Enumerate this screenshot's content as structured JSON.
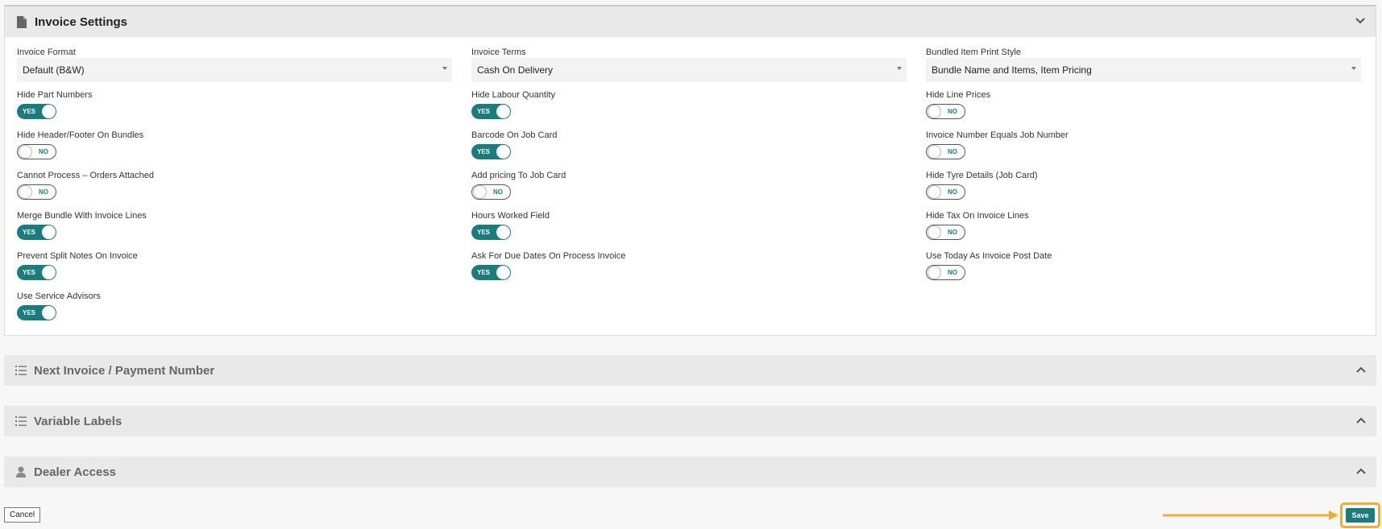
{
  "sections": {
    "invoice_settings": {
      "title": "Invoice Settings",
      "icon": "document-icon",
      "state": "expanded"
    },
    "next_invoice": {
      "title": "Next Invoice / Payment Number",
      "icon": "numbered-list-icon",
      "state": "collapsed"
    },
    "variable_labels": {
      "title": "Variable Labels",
      "icon": "numbered-list-icon",
      "state": "collapsed"
    },
    "dealer_access": {
      "title": "Dealer Access",
      "icon": "user-icon",
      "state": "collapsed"
    }
  },
  "selects": {
    "invoice_format": {
      "label": "Invoice Format",
      "value": "Default (B&W)"
    },
    "invoice_terms": {
      "label": "Invoice Terms",
      "value": "Cash On Delivery"
    },
    "bundled_print_style": {
      "label": "Bundled Item Print Style",
      "value": "Bundle Name and Items, Item Pricing"
    }
  },
  "toggles": {
    "col1": [
      {
        "label": "Hide Part Numbers",
        "state": "YES"
      },
      {
        "label": "Hide Header/Footer On Bundles",
        "state": "NO"
      },
      {
        "label": "Cannot Process – Orders Attached",
        "state": "NO"
      },
      {
        "label": "Merge Bundle With Invoice Lines",
        "state": "YES"
      },
      {
        "label": "Prevent Split Notes On Invoice",
        "state": "YES"
      },
      {
        "label": "Use Service Advisors",
        "state": "YES"
      }
    ],
    "col2": [
      {
        "label": "Hide Labour Quantity",
        "state": "YES"
      },
      {
        "label": "Barcode On Job Card",
        "state": "YES"
      },
      {
        "label": "Add pricing To Job Card",
        "state": "NO"
      },
      {
        "label": "Hours Worked Field",
        "state": "YES"
      },
      {
        "label": "Ask For Due Dates On Process Invoice",
        "state": "YES"
      }
    ],
    "col3": [
      {
        "label": "Hide Line Prices",
        "state": "NO"
      },
      {
        "label": "Invoice Number Equals Job Number",
        "state": "NO"
      },
      {
        "label": "Hide Tyre Details (Job Card)",
        "state": "NO"
      },
      {
        "label": "Hide Tax On Invoice Lines",
        "state": "NO"
      },
      {
        "label": "Use Today As Invoice Post Date",
        "state": "NO"
      }
    ]
  },
  "buttons": {
    "cancel": "Cancel",
    "save": "Save"
  },
  "colors": {
    "accent": "#1a7c7c",
    "highlight": "#f0ad30",
    "header_bg": "#e9e9e9"
  }
}
